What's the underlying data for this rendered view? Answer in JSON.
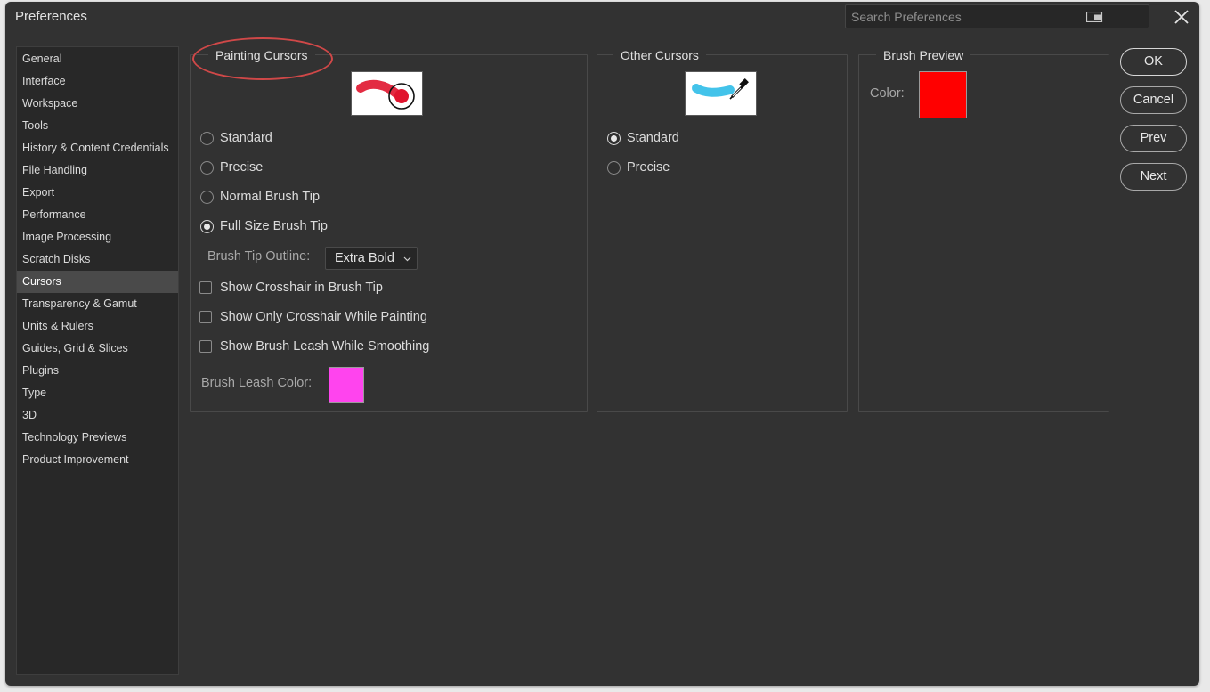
{
  "window": {
    "title": "Preferences",
    "search_placeholder": "Search Preferences"
  },
  "sidebar": {
    "items": [
      {
        "label": "General"
      },
      {
        "label": "Interface"
      },
      {
        "label": "Workspace"
      },
      {
        "label": "Tools"
      },
      {
        "label": "History & Content Credentials"
      },
      {
        "label": "File Handling"
      },
      {
        "label": "Export"
      },
      {
        "label": "Performance"
      },
      {
        "label": "Image Processing"
      },
      {
        "label": "Scratch Disks"
      },
      {
        "label": "Cursors",
        "selected": true
      },
      {
        "label": "Transparency & Gamut"
      },
      {
        "label": "Units & Rulers"
      },
      {
        "label": "Guides, Grid & Slices"
      },
      {
        "label": "Plugins"
      },
      {
        "label": "Type"
      },
      {
        "label": "3D"
      },
      {
        "label": "Technology Previews"
      },
      {
        "label": "Product Improvement"
      }
    ]
  },
  "painting_cursors": {
    "title": "Painting Cursors",
    "options": [
      {
        "label": "Standard",
        "checked": false
      },
      {
        "label": "Precise",
        "checked": false
      },
      {
        "label": "Normal Brush Tip",
        "checked": false
      },
      {
        "label": "Full Size Brush Tip",
        "checked": true
      }
    ],
    "brush_tip_outline_label": "Brush Tip Outline:",
    "brush_tip_outline_value": "Extra Bold",
    "checkboxes": [
      {
        "label": "Show Crosshair in Brush Tip",
        "checked": false
      },
      {
        "label": "Show Only Crosshair While Painting",
        "checked": false
      },
      {
        "label": "Show Brush Leash While Smoothing",
        "checked": false
      }
    ],
    "brush_leash_color_label": "Brush Leash Color:",
    "brush_leash_color": "#ff44ee",
    "preview_stroke_color": "#e0142e"
  },
  "other_cursors": {
    "title": "Other Cursors",
    "options": [
      {
        "label": "Standard",
        "checked": true
      },
      {
        "label": "Precise",
        "checked": false
      }
    ],
    "preview_stroke_color": "#22b8e6"
  },
  "brush_preview": {
    "title": "Brush Preview",
    "color_label": "Color:",
    "color": "#ff0000"
  },
  "buttons": {
    "ok": "OK",
    "cancel": "Cancel",
    "prev": "Prev",
    "next": "Next"
  },
  "colors": {
    "background": "#323232",
    "sidebar_bg": "#282828",
    "selected_item": "#4a4a4a",
    "annotation": "#d04848"
  }
}
